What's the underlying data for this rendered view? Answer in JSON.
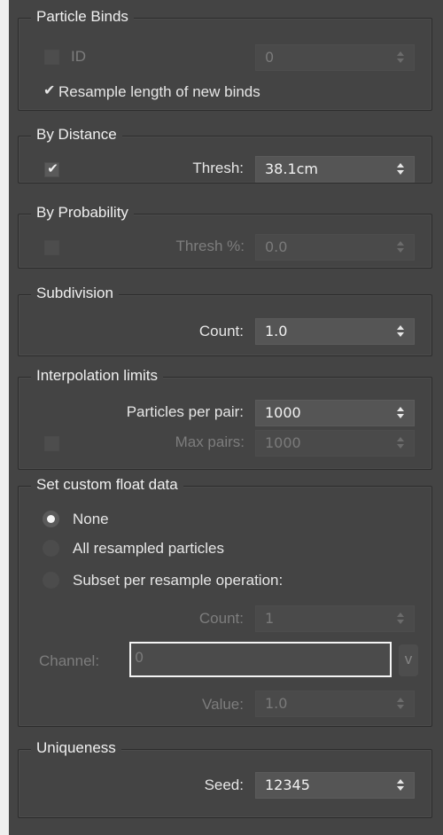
{
  "particle_binds": {
    "title": "Particle Binds",
    "id_label": "ID",
    "id_value": "0",
    "resample_label": "Resample length of new binds",
    "checkmark": "✔"
  },
  "by_distance": {
    "title": "By Distance",
    "thresh_label": "Thresh:",
    "thresh_value": "38.1cm",
    "checkmark": "✔"
  },
  "by_probability": {
    "title": "By Probability",
    "thresh_label": "Thresh %:",
    "thresh_value": "0.0"
  },
  "subdivision": {
    "title": "Subdivision",
    "count_label": "Count:",
    "count_value": "1.0"
  },
  "interpolation": {
    "title": "Interpolation limits",
    "ppp_label": "Particles per pair:",
    "ppp_value": "1000",
    "max_label": "Max pairs:",
    "max_value": "1000"
  },
  "custom_float": {
    "title": "Set custom float data",
    "options": [
      "None",
      "All resampled particles",
      "Subset per resample operation:"
    ],
    "selected": "None",
    "count_label": "Count:",
    "count_value": "1",
    "channel_label": "Channel:",
    "channel_value": "0",
    "v_button": "v",
    "value_label": "Value:",
    "value_value": "1.0"
  },
  "uniqueness": {
    "title": "Uniqueness",
    "seed_label": "Seed:",
    "seed_value": "12345"
  }
}
